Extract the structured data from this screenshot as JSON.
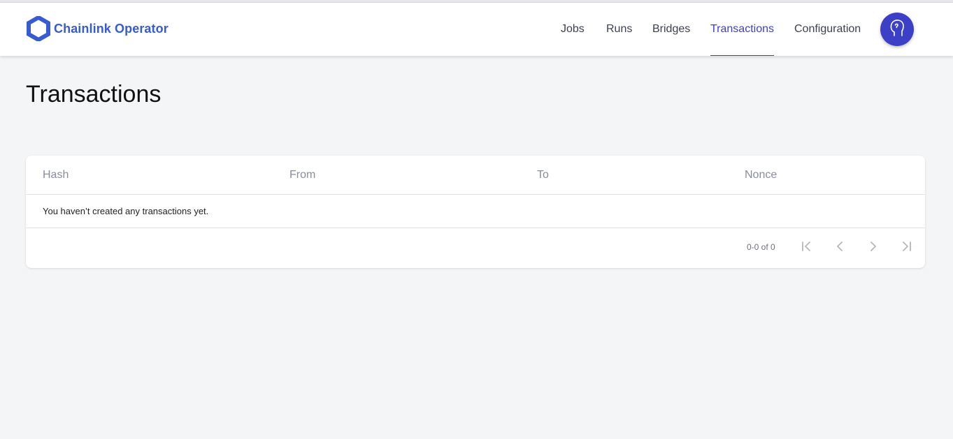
{
  "app": {
    "logo_icon": "chainlink-hexagon-icon",
    "name": "Chainlink Operator",
    "brand_color": "#375bd2",
    "accent_color": "#3c40c6"
  },
  "nav": {
    "items": [
      {
        "label": "Jobs",
        "active": false
      },
      {
        "label": "Runs",
        "active": false
      },
      {
        "label": "Bridges",
        "active": false
      },
      {
        "label": "Transactions",
        "active": true
      },
      {
        "label": "Configuration",
        "active": false
      }
    ],
    "avatar_icon": "user-avatar-icon"
  },
  "page": {
    "title": "Transactions"
  },
  "table": {
    "columns": [
      "Hash",
      "From",
      "To",
      "Nonce"
    ],
    "empty_message": "You haven’t created any transactions yet."
  },
  "pagination": {
    "range_text": "0-0 of 0",
    "buttons": [
      "first-page-icon",
      "previous-page-icon",
      "next-page-icon",
      "last-page-icon"
    ]
  }
}
